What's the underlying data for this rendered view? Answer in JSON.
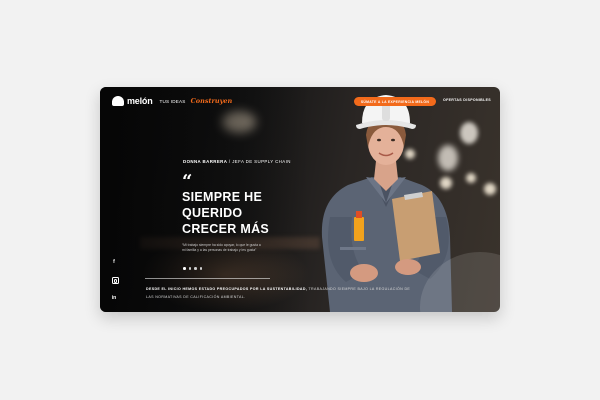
{
  "brand": {
    "logo_text": "melón",
    "tagline": "TUS IDEAS",
    "tagline_script": "Construyen"
  },
  "header": {
    "cta_label": "SÚMATE A LA EXPERIENCIA MELÓN",
    "offers_label": "OFERTAS DISPONIBLES"
  },
  "hero": {
    "person_name": "DONNA BARRERA",
    "person_separator": " / ",
    "person_role": "JEFA DE SUPPLY CHAIN",
    "quote_mark": "“",
    "headline": [
      "SIEMPRE HE",
      "QUERIDO",
      "CRECER MÁS"
    ],
    "body": "“Mi trabajo siempre ha sido apoyar, lo que le gusta a mi familia y a las personas de trabajo y les gusta”",
    "slide_count": 4,
    "active_slide": 1
  },
  "footer": {
    "strong_text": "DESDE EL INICIO HEMOS ESTADO PREOCUPADOS POR LA SUSTENTABILIDAD,",
    "rest_text": "TRABAJANDO SIEMPRE BAJO LA REGULACIÓN DE LAS NORMATIVAS DE CALIFICACIÓN AMBIENTAL."
  },
  "social": {
    "facebook_glyph": "f",
    "linkedin_glyph": "in"
  },
  "colors": {
    "accent": "#f26a1b",
    "background": "#0b0b0c",
    "page": "#f2f2f2"
  }
}
